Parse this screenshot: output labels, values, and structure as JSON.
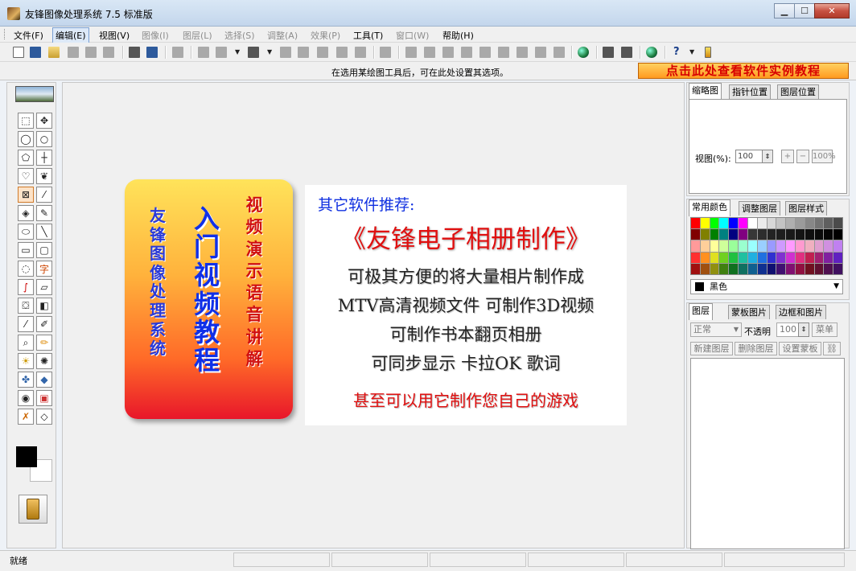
{
  "window": {
    "title": "友锋图像处理系统 7.5 标准版",
    "buttons": [
      "minimize",
      "maximize",
      "close"
    ]
  },
  "menu": [
    {
      "label": "文件(F)",
      "enabled": true
    },
    {
      "label": "编辑(E)",
      "enabled": true,
      "active": true
    },
    {
      "label": "视图(V)",
      "enabled": true
    },
    {
      "label": "图像(I)",
      "enabled": false
    },
    {
      "label": "图层(L)",
      "enabled": false
    },
    {
      "label": "选择(S)",
      "enabled": false
    },
    {
      "label": "调整(A)",
      "enabled": false
    },
    {
      "label": "效果(P)",
      "enabled": false
    },
    {
      "label": "工具(T)",
      "enabled": true
    },
    {
      "label": "窗口(W)",
      "enabled": false
    },
    {
      "label": "帮助(H)",
      "enabled": true
    }
  ],
  "hint": {
    "text": "在选用某绘图工具后，可在此处设置其选项。",
    "promo": "点击此处查看软件实例教程"
  },
  "ad_left": {
    "col1": "友锋图像处理系统",
    "col2": "入门视频教程",
    "col3": "视频演示语音讲解"
  },
  "ad_right": {
    "recommend": "其它软件推荐:",
    "product": "《友锋电子相册制作》",
    "lines": [
      "可极其方便的将大量相片制作成",
      "MTV高清视频文件  可制作3D视频",
      "可制作书本翻页相册",
      "可同步显示  卡拉OK  歌词"
    ],
    "highlight": "甚至可以用它制作您自己的游戏"
  },
  "navigator": {
    "tabs": [
      "缩略图",
      "指针位置",
      "图层位置"
    ],
    "zoom_label": "视图(%):",
    "zoom_value": "100",
    "plus": "+",
    "minus": "−",
    "zoom_100": "100%"
  },
  "colors": {
    "tabs": [
      "常用颜色",
      "调整图层",
      "图层样式"
    ],
    "selected_name": "黑色",
    "selected_hex": "#000000",
    "palette": [
      "#ff0000",
      "#ffff00",
      "#00ff00",
      "#00ffff",
      "#0000ff",
      "#ff00ff",
      "#ffffff",
      "#ebebeb",
      "#d7d7d7",
      "#c3c3c3",
      "#afafaf",
      "#9b9b9b",
      "#878787",
      "#737373",
      "#5f5f5f",
      "#4b4b4b",
      "#800000",
      "#808000",
      "#008000",
      "#008080",
      "#000080",
      "#800080",
      "#373737",
      "#2d2d2d",
      "#232323",
      "#1e1e1e",
      "#191919",
      "#141414",
      "#0f0f0f",
      "#0a0a0a",
      "#050505",
      "#000000",
      "#ff9a9a",
      "#ffcf9a",
      "#ffff9a",
      "#cfff9a",
      "#9aff9a",
      "#9affcf",
      "#9affff",
      "#9acfff",
      "#9a9aff",
      "#cf9aff",
      "#ff9aff",
      "#ff9acf",
      "#f0b0c0",
      "#e0a0d0",
      "#d090e0",
      "#c080f0",
      "#ff3030",
      "#ff9020",
      "#e0e020",
      "#70d020",
      "#20c040",
      "#20c0a0",
      "#20b0e0",
      "#2070e0",
      "#3030d0",
      "#8030d0",
      "#d030d0",
      "#e03080",
      "#c02050",
      "#a02070",
      "#8020a0",
      "#6020c0",
      "#a01010",
      "#a05010",
      "#909010",
      "#408010",
      "#107020",
      "#107060",
      "#106090",
      "#103090",
      "#101070",
      "#401070",
      "#801070",
      "#901040",
      "#701020",
      "#601030",
      "#501050",
      "#401060"
    ]
  },
  "layers": {
    "tabs": [
      "图层",
      "蒙板图片",
      "边框和图片"
    ],
    "blend_mode": "正常",
    "opacity_label": "不透明",
    "opacity_value": "100",
    "menu_btn": "菜单",
    "buttons": [
      "新建图层",
      "删除图层",
      "设置蒙板"
    ]
  },
  "status": {
    "text": "就绪"
  },
  "tools": [
    "rect-select-icon",
    "move-icon",
    "ellipse-select-icon",
    "circle-select-icon",
    "polygon-select-icon",
    "crosshair-icon",
    "lasso-icon",
    "magic-lasso-icon",
    "smart-select-icon",
    "magic-wand-icon",
    "stamp-icon",
    "pencil-icon",
    "ellipse-icon",
    "line-icon",
    "rectangle-icon",
    "rounded-rect-icon",
    "freeform-icon",
    "text-icon",
    "curve-icon",
    "eraser-icon",
    "bucket-icon",
    "gradient-icon",
    "eyedropper-icon",
    "brush-icon",
    "zoom-icon",
    "highlighter-icon",
    "lighten-icon",
    "darken-icon",
    "sponge-icon",
    "blur-icon",
    "red-eye-icon",
    "frame-icon",
    "clone-icon",
    "sharpen-icon"
  ]
}
